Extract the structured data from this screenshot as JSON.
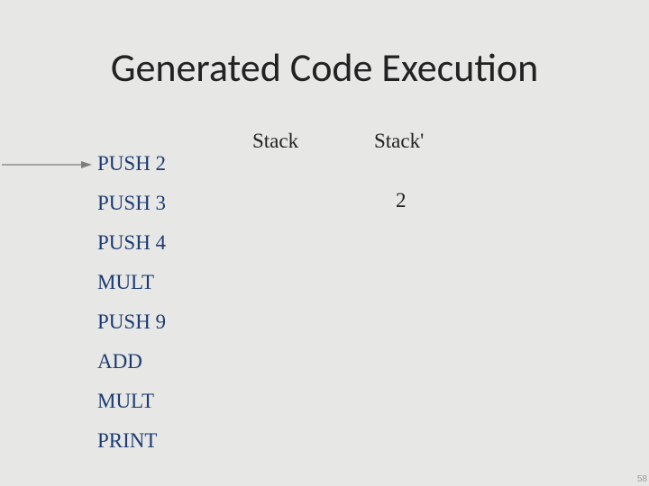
{
  "title": "Generated Code Execution",
  "stack_headers": {
    "left": "Stack",
    "right": "Stack'"
  },
  "instructions": [
    "PUSH 2",
    "PUSH 3",
    "PUSH 4",
    "MULT",
    "PUSH 9",
    "ADD",
    "MULT",
    "PRINT"
  ],
  "stack_prime_values": [
    "2"
  ],
  "page_number": "58"
}
